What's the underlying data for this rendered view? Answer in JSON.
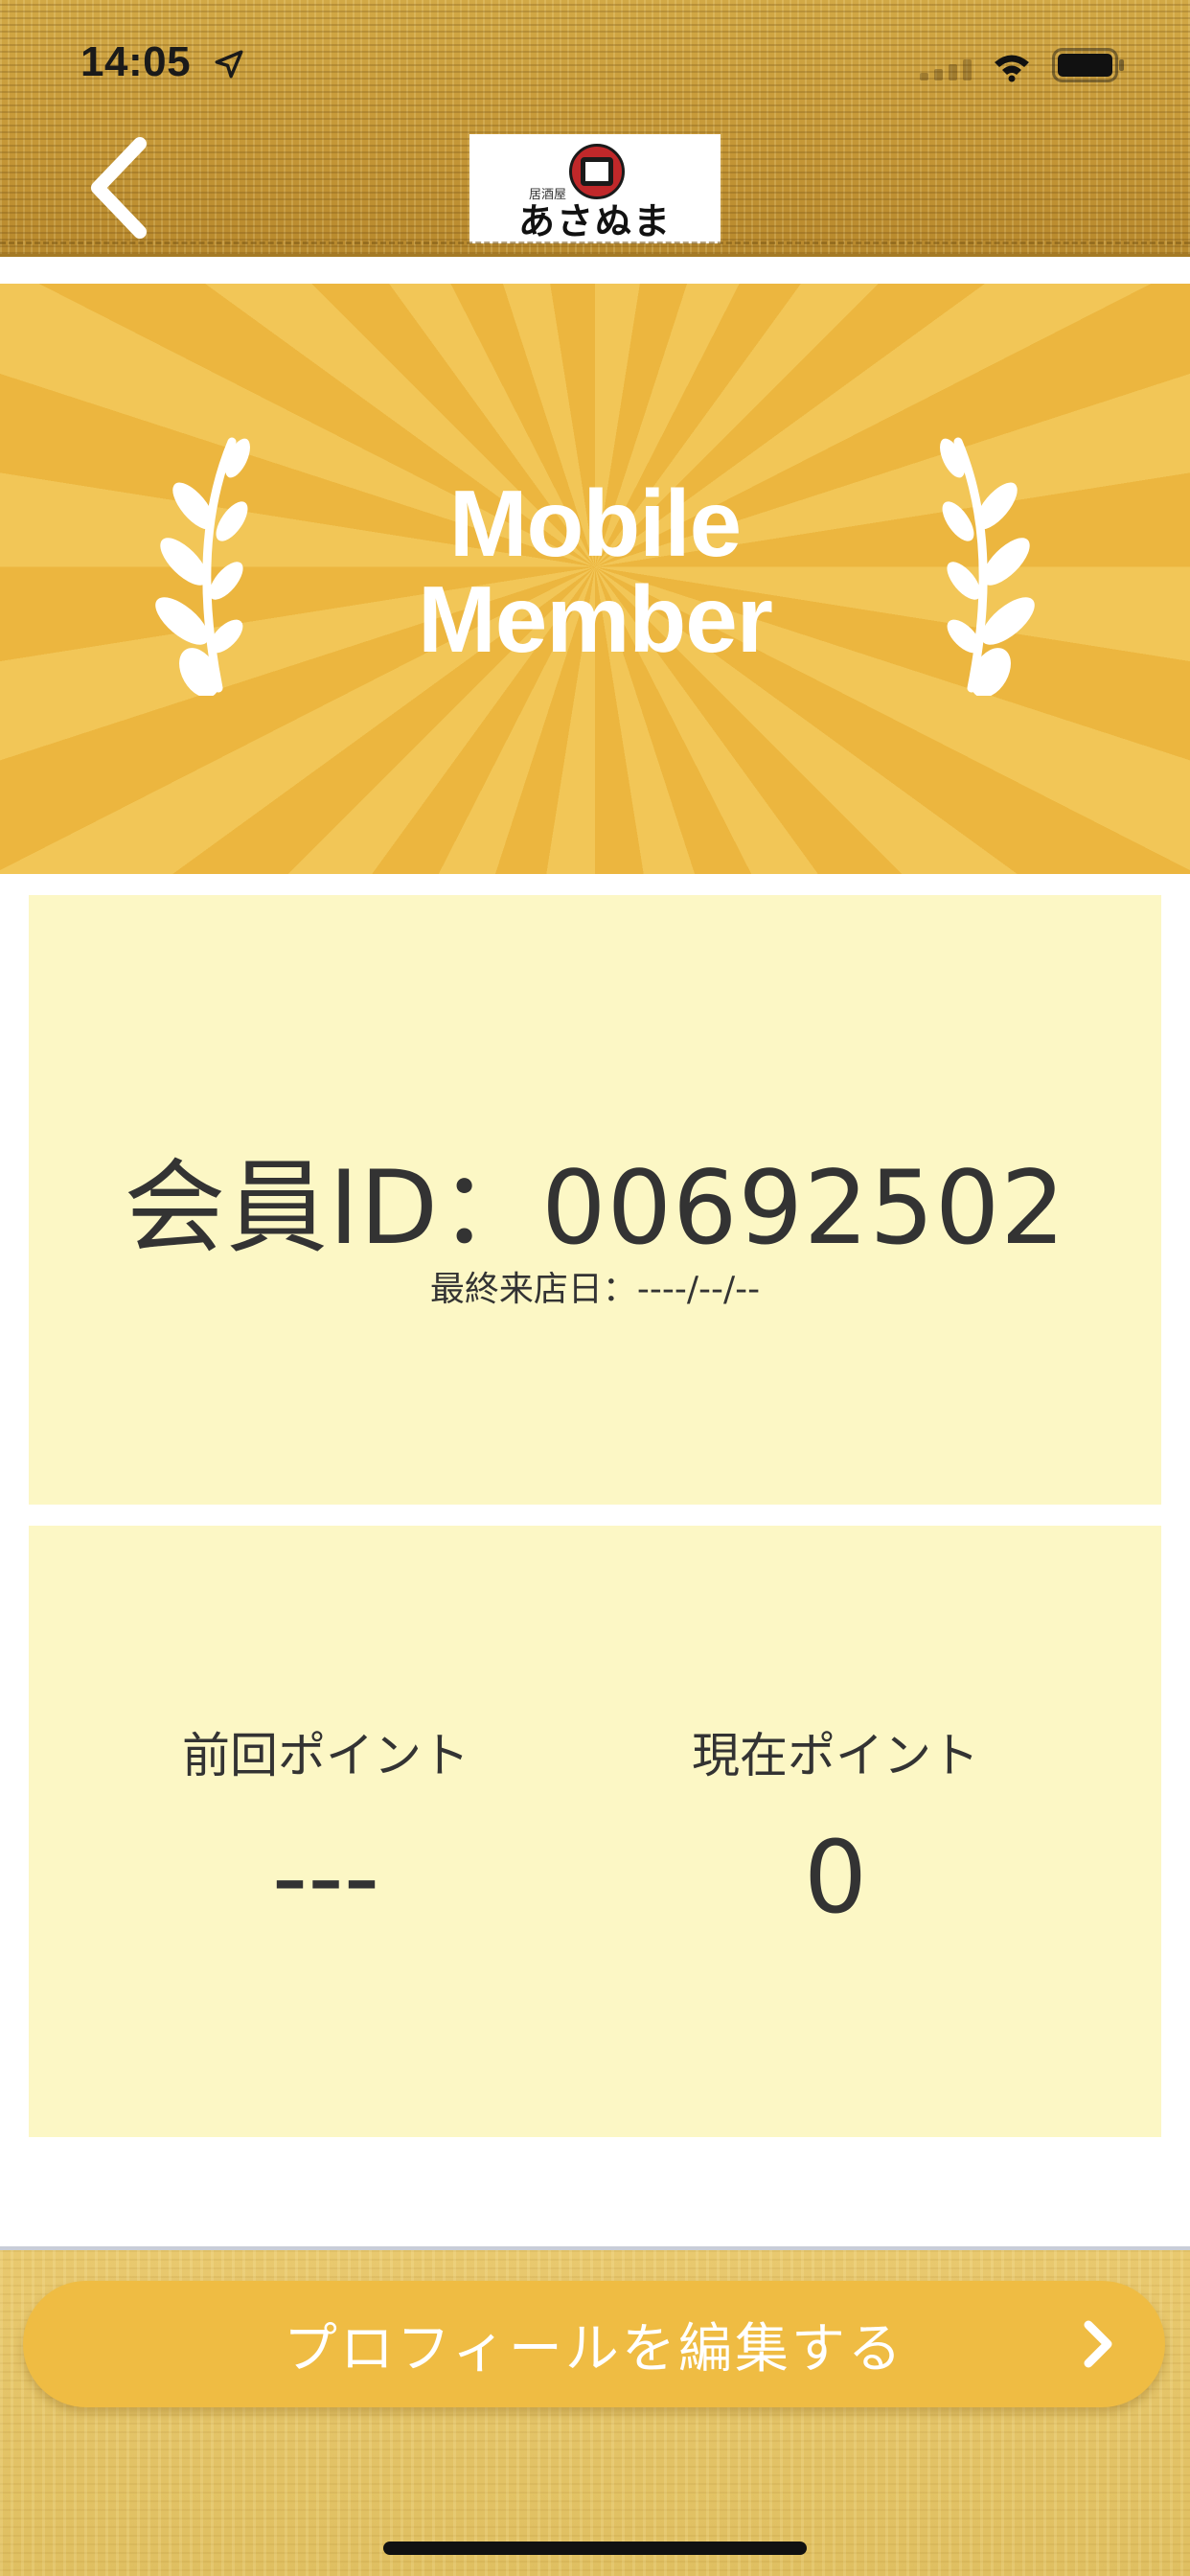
{
  "status_bar": {
    "time": "14:05",
    "location_icon": "location-arrow-icon",
    "signal_icon": "signal-icon",
    "wifi_icon": "wifi-icon",
    "battery_icon": "battery-icon"
  },
  "header": {
    "back_icon": "chevron-left-icon",
    "logo": {
      "small_text": "居酒屋",
      "name": "あさぬま"
    }
  },
  "banner": {
    "title_line1": "Mobile",
    "title_line2": "Member",
    "color": "#efbd45"
  },
  "member": {
    "id_label": "会員ID",
    "separator": "：",
    "id_value": "00692502",
    "last_visit_label": "最終来店日：",
    "last_visit_value": "----/--/--"
  },
  "points": {
    "previous_label": "前回ポイント",
    "previous_value": "---",
    "current_label": "現在ポイント",
    "current_value": "0"
  },
  "footer": {
    "edit_profile_label": "プロフィールを編集する",
    "chevron_icon": "chevron-right-icon",
    "button_color": "#efbc43"
  },
  "colors": {
    "card_background": "#fcf7c5",
    "header_background": "#c79d3a",
    "text": "#333333"
  }
}
